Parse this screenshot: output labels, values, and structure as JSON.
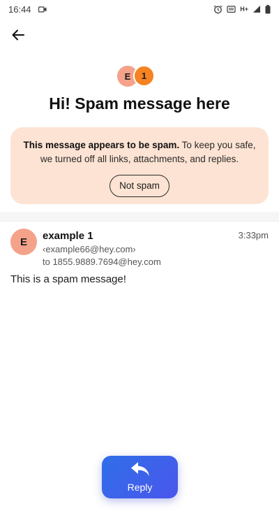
{
  "status_bar": {
    "time": "16:44",
    "network": "H+",
    "icons": [
      "camera-icon",
      "alarm-icon",
      "cast-icon",
      "signal-icon",
      "battery-icon"
    ]
  },
  "toolbar": {
    "back_icon": "arrow-left-icon"
  },
  "thread": {
    "avatar_primary_initial": "E",
    "avatar_count": "1",
    "subject": "Hi! Spam message here"
  },
  "spam_banner": {
    "bold_text": "This message appears to be spam.",
    "rest_text": "To keep you safe, we turned off all links, attachments, and replies.",
    "button_label": "Not spam"
  },
  "message": {
    "avatar_initial": "E",
    "sender_name": "example 1",
    "sender_email": "‹example66@hey.com›",
    "recipient": "to 1855.9889.7694@hey.com",
    "time": "3:33pm",
    "body": "This is a spam message!"
  },
  "reply": {
    "label": "Reply",
    "icon": "reply-icon"
  },
  "colors": {
    "banner_bg": "#fde3d3",
    "avatar_peach": "#f4a28a",
    "avatar_orange": "#f58322",
    "reply_gradient_start": "#2f6fe8",
    "reply_gradient_end": "#4a56ec"
  }
}
